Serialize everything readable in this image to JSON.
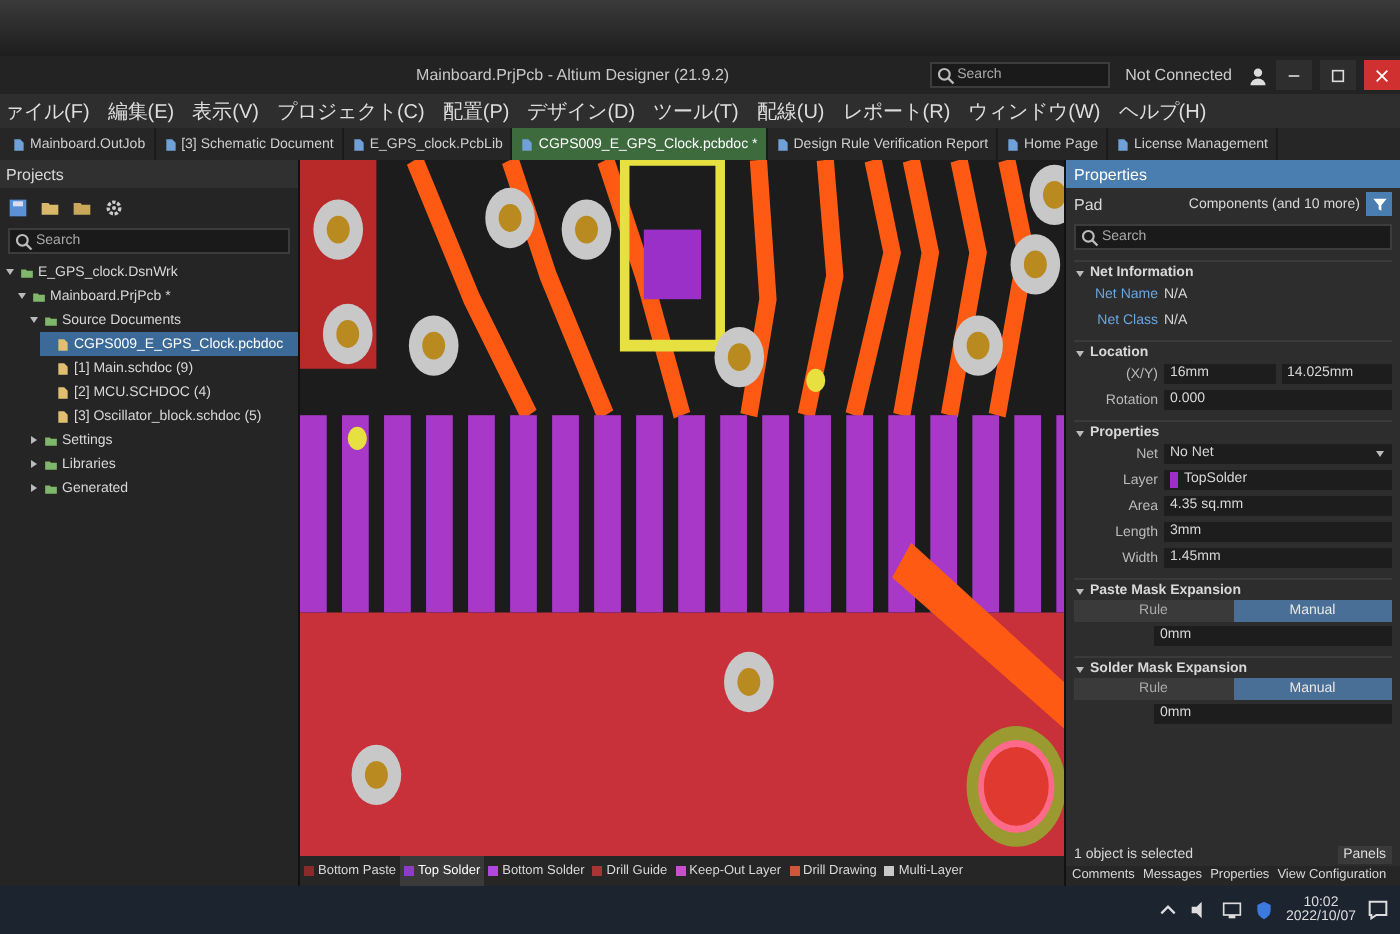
{
  "window": {
    "title": "Mainboard.PrjPcb - Altium Designer (21.9.2)",
    "search": {
      "placeholder": "Search"
    },
    "connection": "Not Connected"
  },
  "menu": [
    "ァイル(F)",
    "編集(E)",
    "表示(V)",
    "プロジェクト(C)",
    "配置(P)",
    "デザイン(D)",
    "ツール(T)",
    "配線(U)",
    "レポート(R)",
    "ウィンドウ(W)",
    "ヘルプ(H)"
  ],
  "documents": [
    {
      "label": "Mainboard.OutJob",
      "selected": false
    },
    {
      "label": "[3] Schematic Document",
      "selected": false
    },
    {
      "label": "E_GPS_clock.PcbLib",
      "selected": false
    },
    {
      "label": "CGPS009_E_GPS_Clock.pcbdoc *",
      "selected": true
    },
    {
      "label": "Design Rule Verification Report",
      "selected": false
    },
    {
      "label": "Home Page",
      "selected": false
    },
    {
      "label": "License Management",
      "selected": false
    }
  ],
  "projects": {
    "title": "Projects",
    "search": {
      "placeholder": "Search"
    },
    "tree": [
      {
        "label": "E_GPS_clock.DsnWrk",
        "selected": false,
        "expanded": true,
        "children": [
          {
            "label": "Mainboard.PrjPcb *",
            "selected": false,
            "expanded": true,
            "children": [
              {
                "label": "Source Documents",
                "selected": false,
                "expanded": true,
                "children": [
                  {
                    "label": "CGPS009_E_GPS_Clock.pcbdoc",
                    "selected": true
                  },
                  {
                    "label": "[1] Main.schdoc (9)",
                    "selected": false
                  },
                  {
                    "label": "[2] MCU.SCHDOC (4)",
                    "selected": false
                  },
                  {
                    "label": "[3] Oscillator_block.schdoc (5)",
                    "selected": false
                  }
                ]
              },
              {
                "label": "Settings",
                "selected": false,
                "expanded": false
              },
              {
                "label": "Libraries",
                "selected": false,
                "expanded": false
              },
              {
                "label": "Generated",
                "selected": false,
                "expanded": false
              }
            ]
          }
        ]
      }
    ]
  },
  "layers": [
    {
      "label": "Bottom Paste",
      "color": "#8a2a2a",
      "selected": false
    },
    {
      "label": "Top Solder",
      "color": "#8e3cc8",
      "selected": true
    },
    {
      "label": "Bottom Solder",
      "color": "#b048e0",
      "selected": false
    },
    {
      "label": "Drill Guide",
      "color": "#a83434",
      "selected": false
    },
    {
      "label": "Keep-Out Layer",
      "color": "#c850c8",
      "selected": false
    },
    {
      "label": "Drill Drawing",
      "color": "#d0583a",
      "selected": false
    },
    {
      "label": "Multi-Layer",
      "color": "#c8c8c8",
      "selected": false
    }
  ],
  "properties": {
    "title": "Properties",
    "object": "Pad",
    "filter": "Components (and 10 more)",
    "search": {
      "placeholder": "Search"
    },
    "sections": [
      {
        "title": "Net Information",
        "rows": [
          {
            "kind": "text",
            "label": "Net Name",
            "value": "N/A"
          },
          {
            "kind": "text",
            "label": "Net Class",
            "value": "N/A"
          }
        ]
      },
      {
        "title": "Location",
        "rows": [
          {
            "kind": "pair",
            "label": "(X/Y)",
            "values": [
              "16mm",
              "14.025mm"
            ]
          },
          {
            "kind": "field",
            "label": "Rotation",
            "value": "0.000"
          }
        ]
      },
      {
        "title": "Properties",
        "rows": [
          {
            "kind": "dropdown",
            "label": "Net",
            "value": "No Net"
          },
          {
            "kind": "layer",
            "label": "Layer",
            "value": "TopSolder"
          },
          {
            "kind": "field",
            "label": "Area",
            "value": "4.35 sq.mm"
          },
          {
            "kind": "field",
            "label": "Length",
            "value": "3mm"
          },
          {
            "kind": "field",
            "label": "Width",
            "value": "1.45mm"
          }
        ]
      },
      {
        "title": "Paste Mask Expansion",
        "options": [
          {
            "label": "Rule",
            "selected": false
          },
          {
            "label": "Manual",
            "selected": true
          }
        ],
        "value": "0mm"
      },
      {
        "title": "Solder Mask Expansion",
        "options": [
          {
            "label": "Rule",
            "selected": false
          },
          {
            "label": "Manual",
            "selected": true
          }
        ],
        "value": "0mm"
      }
    ],
    "status": "1 object is selected",
    "panel_tabs": [
      "Comments",
      "Messages",
      "Properties",
      "View Configuration"
    ],
    "panels_button": "Panels"
  },
  "taskbar": {
    "time": "10:02",
    "date": "2022/10/07"
  }
}
